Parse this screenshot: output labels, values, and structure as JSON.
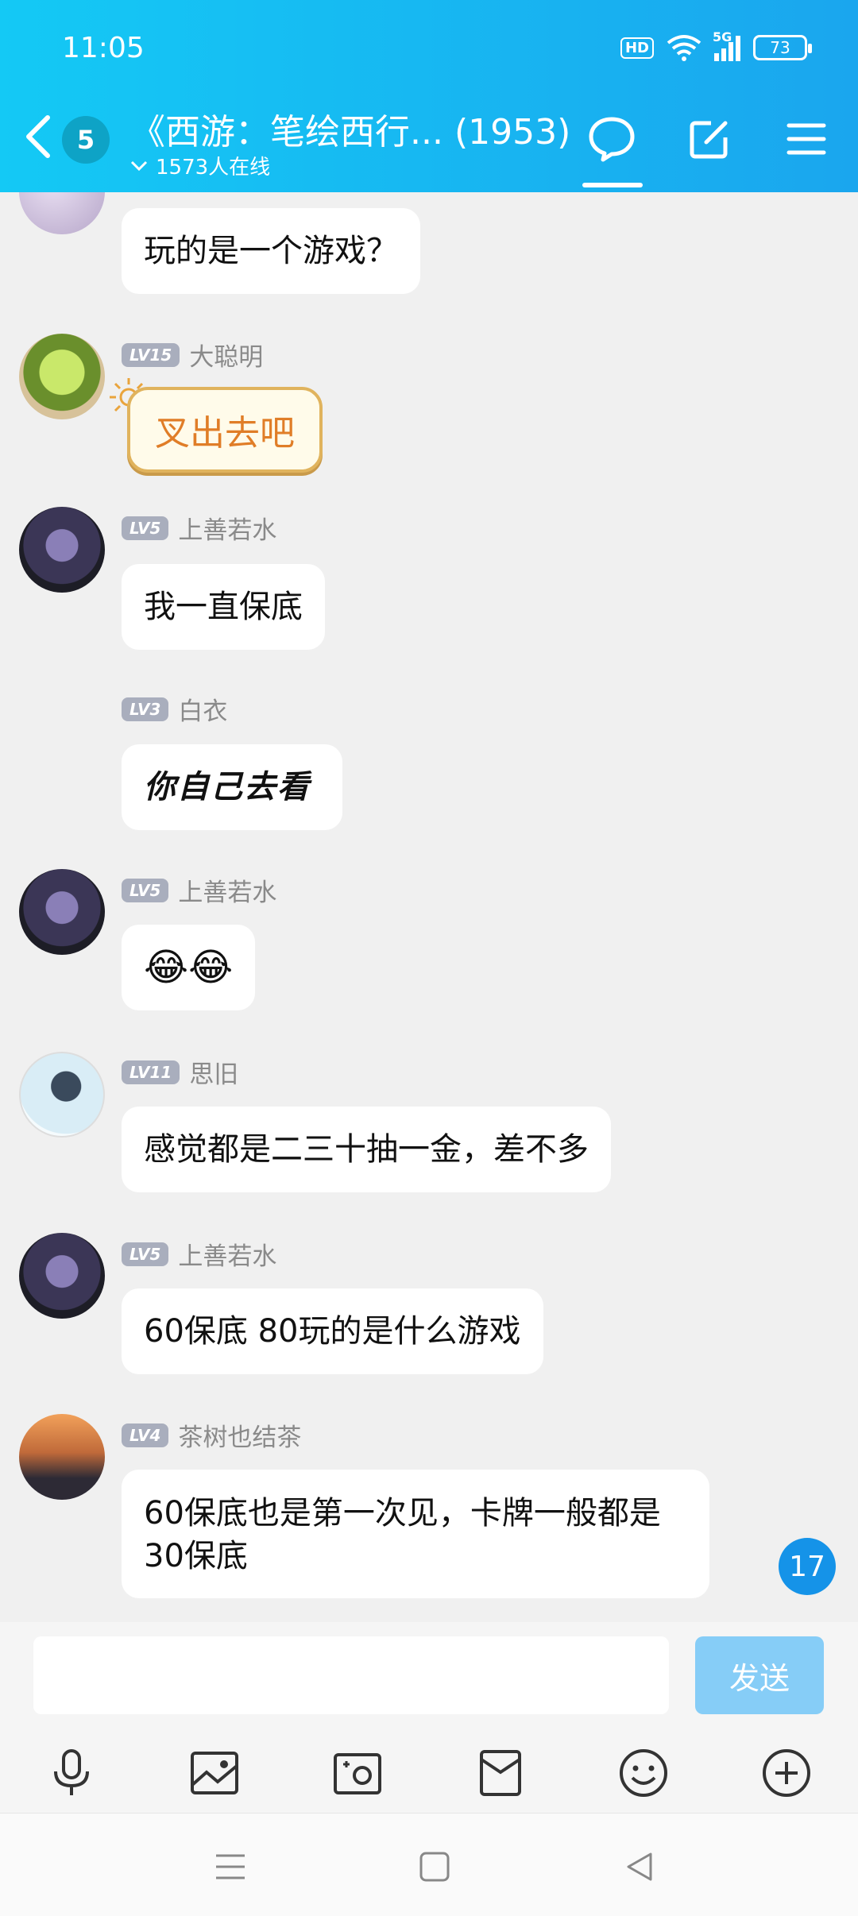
{
  "status_bar": {
    "time": "11:05",
    "hd": "HD",
    "network": "5G",
    "battery": "73"
  },
  "header": {
    "unread_count": "5",
    "title": "《西游：笔绘西行... (1953)",
    "online": "1573人在线"
  },
  "messages": [
    {
      "text": "玩的是一个游戏？"
    },
    {
      "level": "LV15",
      "name": "大聪明",
      "sticker_text": "叉出去吧"
    },
    {
      "level": "LV5",
      "name": "上善若水",
      "text": "我一直保底"
    },
    {
      "level": "LV3",
      "name": "白衣",
      "text": "你自己去看"
    },
    {
      "level": "LV5",
      "name": "上善若水",
      "emoji": "😂😂"
    },
    {
      "level": "LV11",
      "name": "思旧",
      "text": "感觉都是二三十抽一金，差不多"
    },
    {
      "level": "LV5",
      "name": "上善若水",
      "text": "60保底 80玩的是什么游戏"
    },
    {
      "level": "LV4",
      "name": "茶树也结茶",
      "text": " 60保底也是第一次见，卡牌一般都是30保底"
    }
  ],
  "new_message_count": "17",
  "input": {
    "placeholder": "",
    "send_label": "发送"
  },
  "colors": {
    "header_start": "#14c9f5",
    "header_end": "#1aa6ee",
    "send_disabled": "#86cdf7",
    "level_badge": "#a9aebd"
  }
}
